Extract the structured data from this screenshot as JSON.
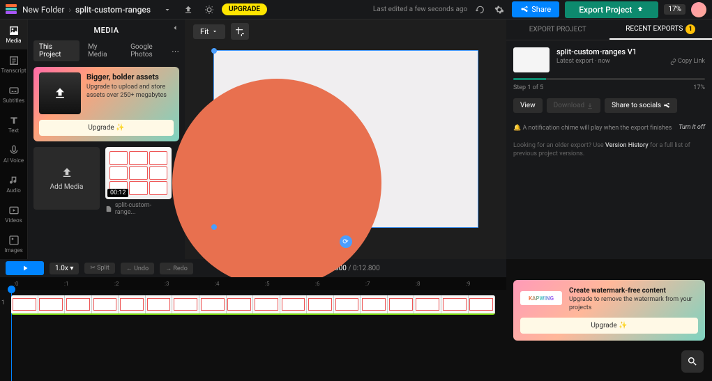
{
  "topbar": {
    "folder": "New Folder",
    "project": "split-custom-ranges",
    "upgrade": "UPGRADE",
    "last_edited": "Last edited a few seconds ago",
    "share": "Share",
    "export": "Export Project",
    "percent": "17%"
  },
  "sidebar": {
    "items": [
      "Media",
      "Transcript",
      "Subtitles",
      "Text",
      "AI Voice",
      "Audio",
      "Videos",
      "Images"
    ]
  },
  "media": {
    "title": "MEDIA",
    "tabs": [
      "This Project",
      "My Media",
      "Google Photos"
    ],
    "promo_title": "Bigger, bolder assets",
    "promo_desc": "Upgrade to upload and store assets over 250+ megabytes",
    "promo_btn": "Upgrade ✨",
    "add": "Add Media",
    "thumb_duration": "00:12",
    "thumb_name": "split-custom-range..."
  },
  "canvas": {
    "fit": "Fit"
  },
  "timeline": {
    "zoom": "1.0x",
    "split": "✂ Split",
    "undo": "← Undo",
    "redo": "→ Redo",
    "current": "0:00.000",
    "total": "0:12.800",
    "marks": [
      ":0",
      ":1",
      ":2",
      ":3",
      ":4",
      ":5",
      ":6",
      ":7",
      ":8",
      ":9"
    ]
  },
  "export_panel": {
    "tab1": "EXPORT PROJECT",
    "tab2": "RECENT EXPORTS",
    "badge": "1",
    "title": "split-custom-ranges V1",
    "meta": "Latest export · now",
    "copy": "Copy Link",
    "step": "Step 1 of 5",
    "pct": "17%",
    "view": "View",
    "download": "Download",
    "share_socials": "Share to socials",
    "chime": "A notification chime will play when the export finishes",
    "turn_off": "Turn it off",
    "older1": "Looking for an older export? Use ",
    "older_link": "Version History",
    "older2": " for a full list of previous project versions."
  },
  "watermark": {
    "logo": "KAPWING",
    "title": "Create watermark-free content",
    "desc": "Upgrade to remove the watermark from your projects",
    "btn": "Upgrade ✨"
  }
}
